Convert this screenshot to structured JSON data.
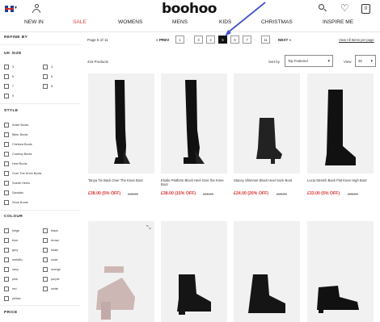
{
  "header": {
    "logo": "boohoo",
    "flag_caret": "▾",
    "heart_glyph": "♡",
    "bag_count": "0"
  },
  "nav": {
    "items": [
      {
        "label": "NEW IN"
      },
      {
        "label": "SALE"
      },
      {
        "label": "WOMENS"
      },
      {
        "label": "MENS"
      },
      {
        "label": "KIDS"
      },
      {
        "label": "CHRISTMAS"
      },
      {
        "label": "INSPIRE ME"
      }
    ]
  },
  "sidebar": {
    "refine_by": "REFINE BY",
    "uk_size": {
      "heading": "UK SIZE",
      "options": [
        "3",
        "4",
        "5",
        "6",
        "7",
        "8",
        "9"
      ]
    },
    "style": {
      "heading": "STYLE",
      "options": [
        "Ankle Boots",
        "Biker Boots",
        "Chelsea Boots",
        "Cowboy Boots",
        "Heel Boots",
        "Over The Knee Boots",
        "Suede Heels",
        "Sandals",
        "Shoe Boots"
      ]
    },
    "colour": {
      "heading": "COLOUR",
      "options": [
        "beige",
        "black",
        "blue",
        "brown",
        "grey",
        "khaki",
        "metallic",
        "nude",
        "navy",
        "orange",
        "pink",
        "purple",
        "red",
        "white",
        "yellow"
      ]
    },
    "price": {
      "heading": "PRICE"
    }
  },
  "toolbar": {
    "page_status": "Page 5 of 11",
    "prev_label": "« PREV",
    "next_label": "NEXT »",
    "pages": [
      "1",
      "3",
      "4",
      "5",
      "6",
      "7",
      "11"
    ],
    "active_page": "5",
    "ellipsis": "...",
    "view_all": "View All Items per page",
    "count": "416 Products",
    "sort_label": "Sort by",
    "sort_value": "Top Featured",
    "view_label": "View",
    "view_value": "48"
  },
  "products": [
    {
      "name": "Tanya Tie Back Over The Knee Boot",
      "price": "£38.00 (5% OFF)",
      "old_price": "£40.00"
    },
    {
      "name": "Elodie Platform Block Heel Over the Knee Boot",
      "price": "£38.00 (15% OFF)",
      "old_price": "£45.00"
    },
    {
      "name": "Stacey Shimmer Block Heel Sock Boot",
      "price": "£24.00 (20% OFF)",
      "old_price": "£30.00"
    },
    {
      "name": "Lucia Stretch Back Flat Knee High Boot",
      "price": "£33.00 (5% OFF)",
      "old_price": "£35.00"
    }
  ],
  "zoom_glyph": "⤡"
}
